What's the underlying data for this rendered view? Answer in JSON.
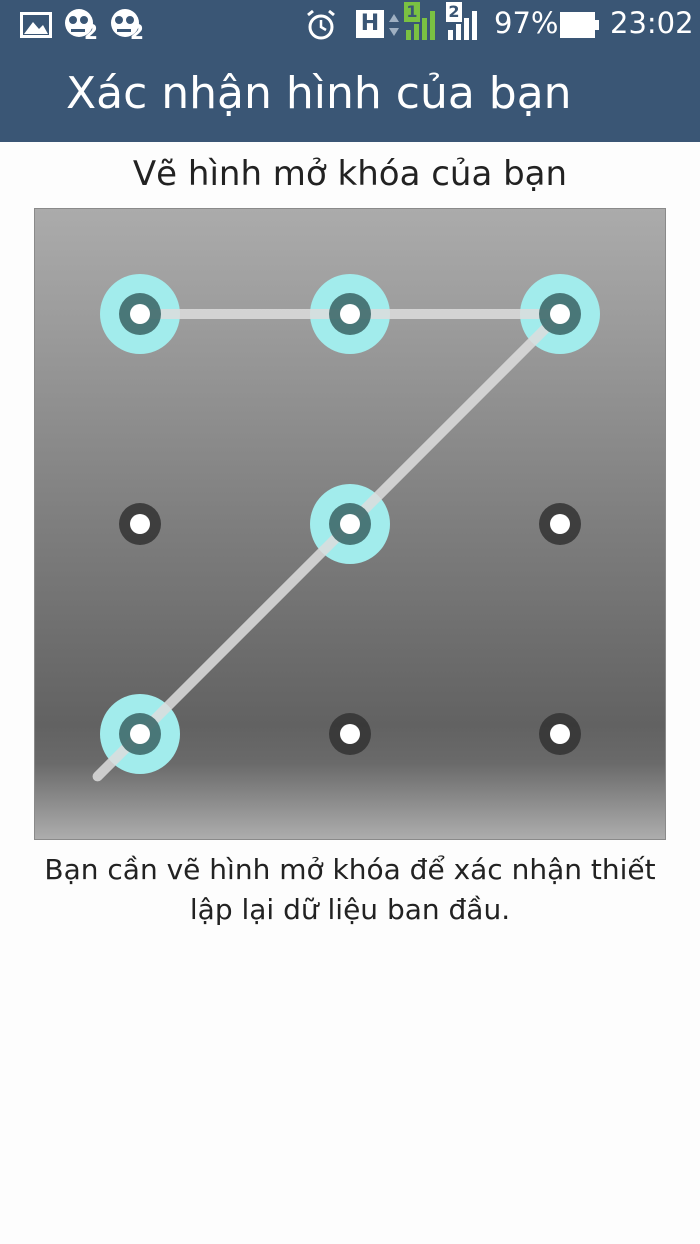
{
  "status_bar": {
    "icons": [
      "gallery-icon",
      "zombie-notification-icon",
      "zombie-notification-icon",
      "alarm-clock-icon",
      "h-network-icon",
      "signal-sim-1-icon",
      "signal-sim-2-icon",
      "battery-icon"
    ],
    "sim1_label": "1",
    "sim2_label": "2",
    "network_type": "H",
    "zombie_badge": "2",
    "battery_level": "97%",
    "time": "23:02"
  },
  "header": {
    "title": "Xác nhận hình của bạn",
    "background": "#3a5675"
  },
  "instruction": "Vẽ hình mở khóa của bạn",
  "pattern": {
    "grid_size": 3,
    "sequence": [
      1,
      2,
      3,
      5,
      7
    ],
    "highlight_color": "#a2ecec",
    "line_color": "#dddddd"
  },
  "description": {
    "line1": "Bạn cần vẽ hình mở khóa để xác nhận thiết",
    "line2": "lập lại dữ liệu ban đầu."
  }
}
